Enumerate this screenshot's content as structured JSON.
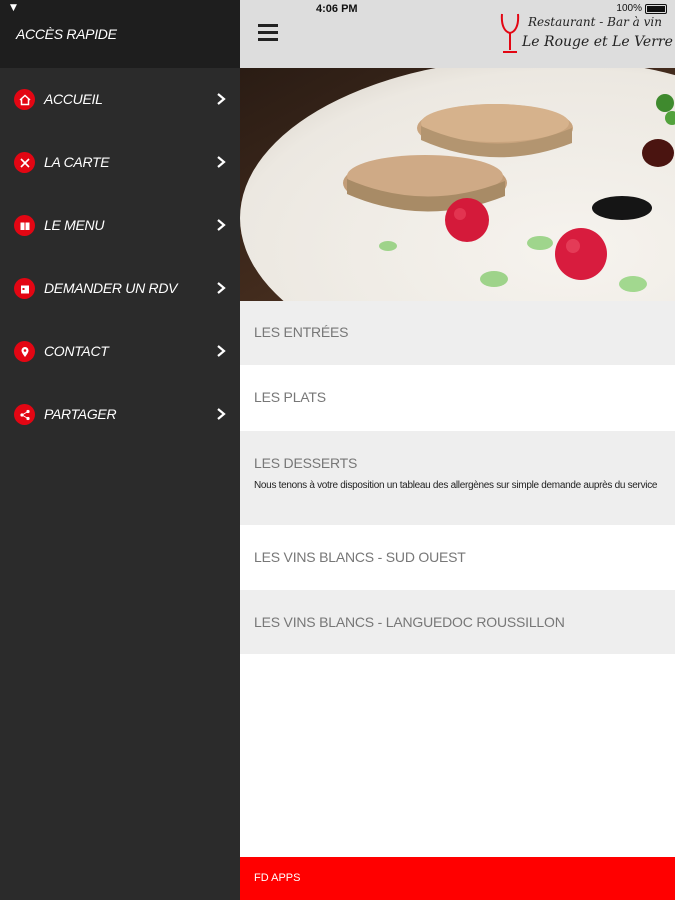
{
  "sidebar": {
    "title": "ACCÈS RAPIDE",
    "items": [
      {
        "label": "ACCUEIL",
        "icon": "home-icon"
      },
      {
        "label": "LA CARTE",
        "icon": "cutlery-icon"
      },
      {
        "label": "LE MENU",
        "icon": "book-icon"
      },
      {
        "label": "DEMANDER UN RDV",
        "icon": "calendar-icon"
      },
      {
        "label": "CONTACT",
        "icon": "location-pin-icon"
      },
      {
        "label": "PARTAGER",
        "icon": "share-icon"
      }
    ]
  },
  "status_bar": {
    "time": "4:06 PM",
    "battery": "100%"
  },
  "header": {
    "logo_line1": "Restaurant - Bar à vin",
    "logo_line2": "Le Rouge et Le Verre"
  },
  "categories": [
    {
      "label": "LES ENTRÉES",
      "note": ""
    },
    {
      "label": "LES PLATS",
      "note": ""
    },
    {
      "label": "LES DESSERTS",
      "note": "Nous tenons à votre disposition un tableau des allergènes sur simple demande auprès du service"
    },
    {
      "label": "LES VINS BLANCS - SUD OUEST",
      "note": ""
    },
    {
      "label": "LES VINS BLANCS - LANGUEDOC ROUSSILLON",
      "note": ""
    }
  ],
  "footer": {
    "label": "FD APPS"
  },
  "colors": {
    "accent": "#e30613",
    "footer": "#ff0000",
    "sidebar_bg": "#2b2b2b"
  }
}
